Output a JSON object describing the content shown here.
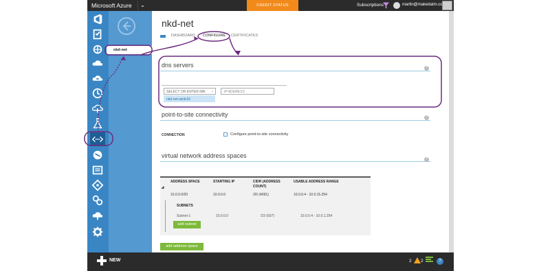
{
  "app": {
    "brand": "Microsoft Azure",
    "credit_status": "CREDIT STATUS",
    "subscriptions": "Subscriptions",
    "user_email": "martin@makedalm.com"
  },
  "nav": {
    "selected_item": "nkd-net"
  },
  "page": {
    "title": "nkd-net",
    "tabs": [
      "DASHBOARD",
      "CONFIGURE",
      "CERTIFICATES"
    ]
  },
  "dns": {
    "heading": "dns servers",
    "select_placeholder": "SELECT OR ENTER NAI",
    "ip_placeholder": "IP ADDRESS",
    "dropdown_option": "nkd-net-wintc01"
  },
  "p2s": {
    "heading": "point-to-site connectivity",
    "connection_label": "CONNECTION",
    "checkbox_label": "Configure point-to-site connectivity"
  },
  "vnet": {
    "heading": "virtual network address spaces",
    "columns": [
      "ADDRESS SPACE",
      "STARTING IP",
      "CIDR (ADDRESS COUNT)",
      "USABLE ADDRESS RANGE"
    ],
    "row": [
      "10.0.0.0/20",
      "10.0.0.0",
      "/20 (4091)",
      "10.0.0.4 - 10.0.15.254"
    ],
    "subnets_label": "SUBNETS",
    "subnet_row": [
      "Subnet-1",
      "10.0.0.0",
      "/23 (507)",
      "10.0.0.4 - 10.0.1.254"
    ],
    "add_subnet": "add subnet",
    "add_space": "add address space"
  },
  "bottom": {
    "new_label": "NEW",
    "warning_count": "2",
    "status_count": "2"
  },
  "colors": {
    "accent_blue": "#3a86c4",
    "nav_blue": "#5499d0",
    "orange": "#f28a1b",
    "green": "#7db93a",
    "callout_purple": "#6c2a7d"
  }
}
